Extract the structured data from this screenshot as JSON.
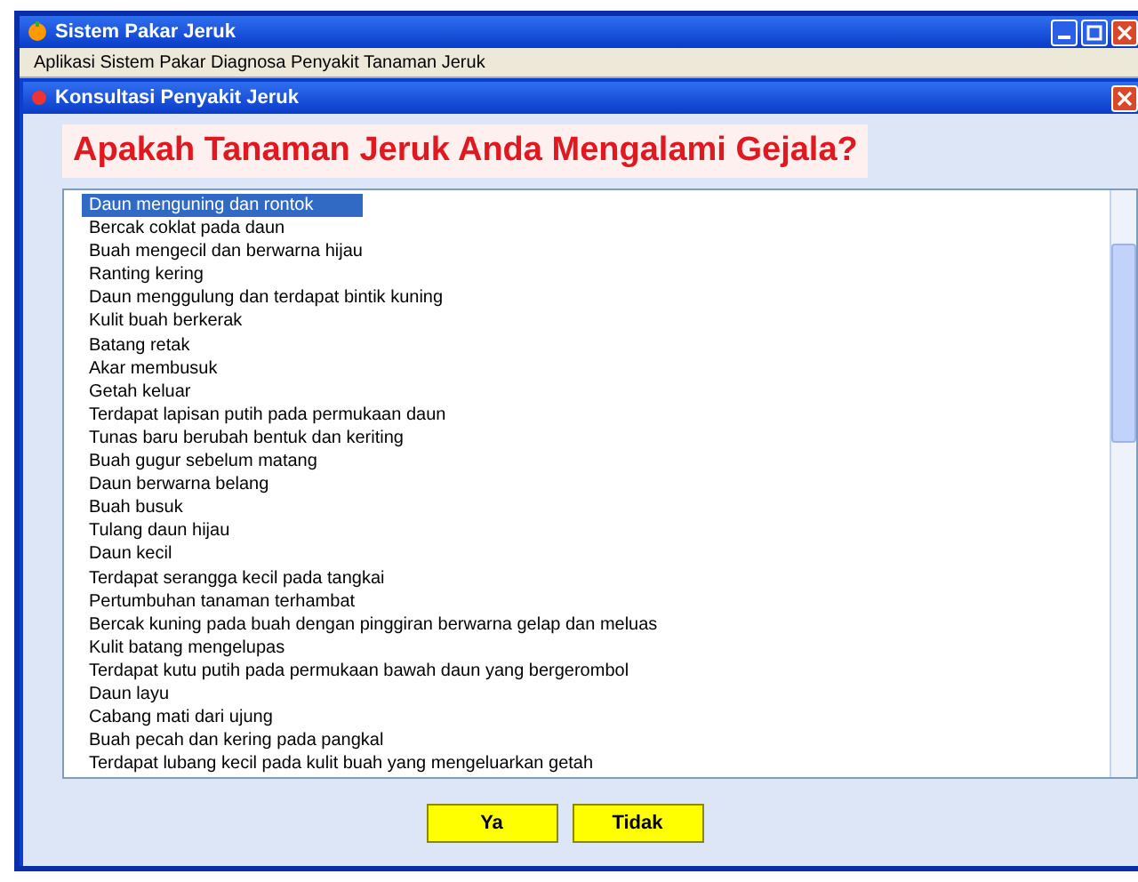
{
  "window": {
    "title": "Sistem Pakar Jeruk"
  },
  "info_bar": {
    "text": "Aplikasi Sistem Pakar Diagnosa Penyakit Tanaman Jeruk"
  },
  "dialog": {
    "title": "Konsultasi Penyakit Jeruk",
    "question": "Apakah Tanaman Jeruk Anda Mengalami Gejala?"
  },
  "symptoms": [
    {
      "label": "Daun menguning dan rontok",
      "selected": true
    },
    {
      "label": "Bercak coklat pada daun",
      "selected": false
    },
    {
      "label": "Buah mengecil dan berwarna hijau",
      "selected": false
    },
    {
      "label": "Ranting kering",
      "selected": false
    },
    {
      "label": "Daun menggulung dan terdapat bintik kuning",
      "selected": false
    },
    {
      "label": "Kulit buah berkerak",
      "selected": false
    },
    {
      "label": "Batang retak",
      "selected": false
    },
    {
      "label": "Akar membusuk",
      "selected": false
    },
    {
      "label": "Getah keluar",
      "selected": false
    },
    {
      "label": "Terdapat lapisan putih pada permukaan daun",
      "selected": false
    },
    {
      "label": "Tunas baru berubah bentuk dan keriting",
      "selected": false
    },
    {
      "label": "Buah gugur sebelum matang",
      "selected": false
    },
    {
      "label": "Daun berwarna belang",
      "selected": false
    },
    {
      "label": "Buah busuk",
      "selected": false
    },
    {
      "label": "Tulang daun hijau",
      "selected": false
    },
    {
      "label": "Daun kecil",
      "selected": false
    },
    {
      "label": "Terdapat serangga kecil pada tangkai",
      "selected": false
    },
    {
      "label": "Pertumbuhan tanaman terhambat",
      "selected": false
    },
    {
      "label": "Bercak kuning pada buah dengan pinggiran berwarna gelap dan meluas",
      "selected": false
    },
    {
      "label": "Kulit batang mengelupas",
      "selected": false
    },
    {
      "label": "Terdapat kutu putih pada permukaan bawah daun yang bergerombol",
      "selected": false
    },
    {
      "label": "Daun layu",
      "selected": false
    },
    {
      "label": "Cabang mati dari ujung",
      "selected": false
    },
    {
      "label": "Buah pecah dan kering pada pangkal",
      "selected": false
    },
    {
      "label": "Terdapat lubang kecil pada kulit buah yang mengeluarkan getah",
      "selected": false
    }
  ],
  "buttons": [
    "Ya",
    "Tidak"
  ]
}
